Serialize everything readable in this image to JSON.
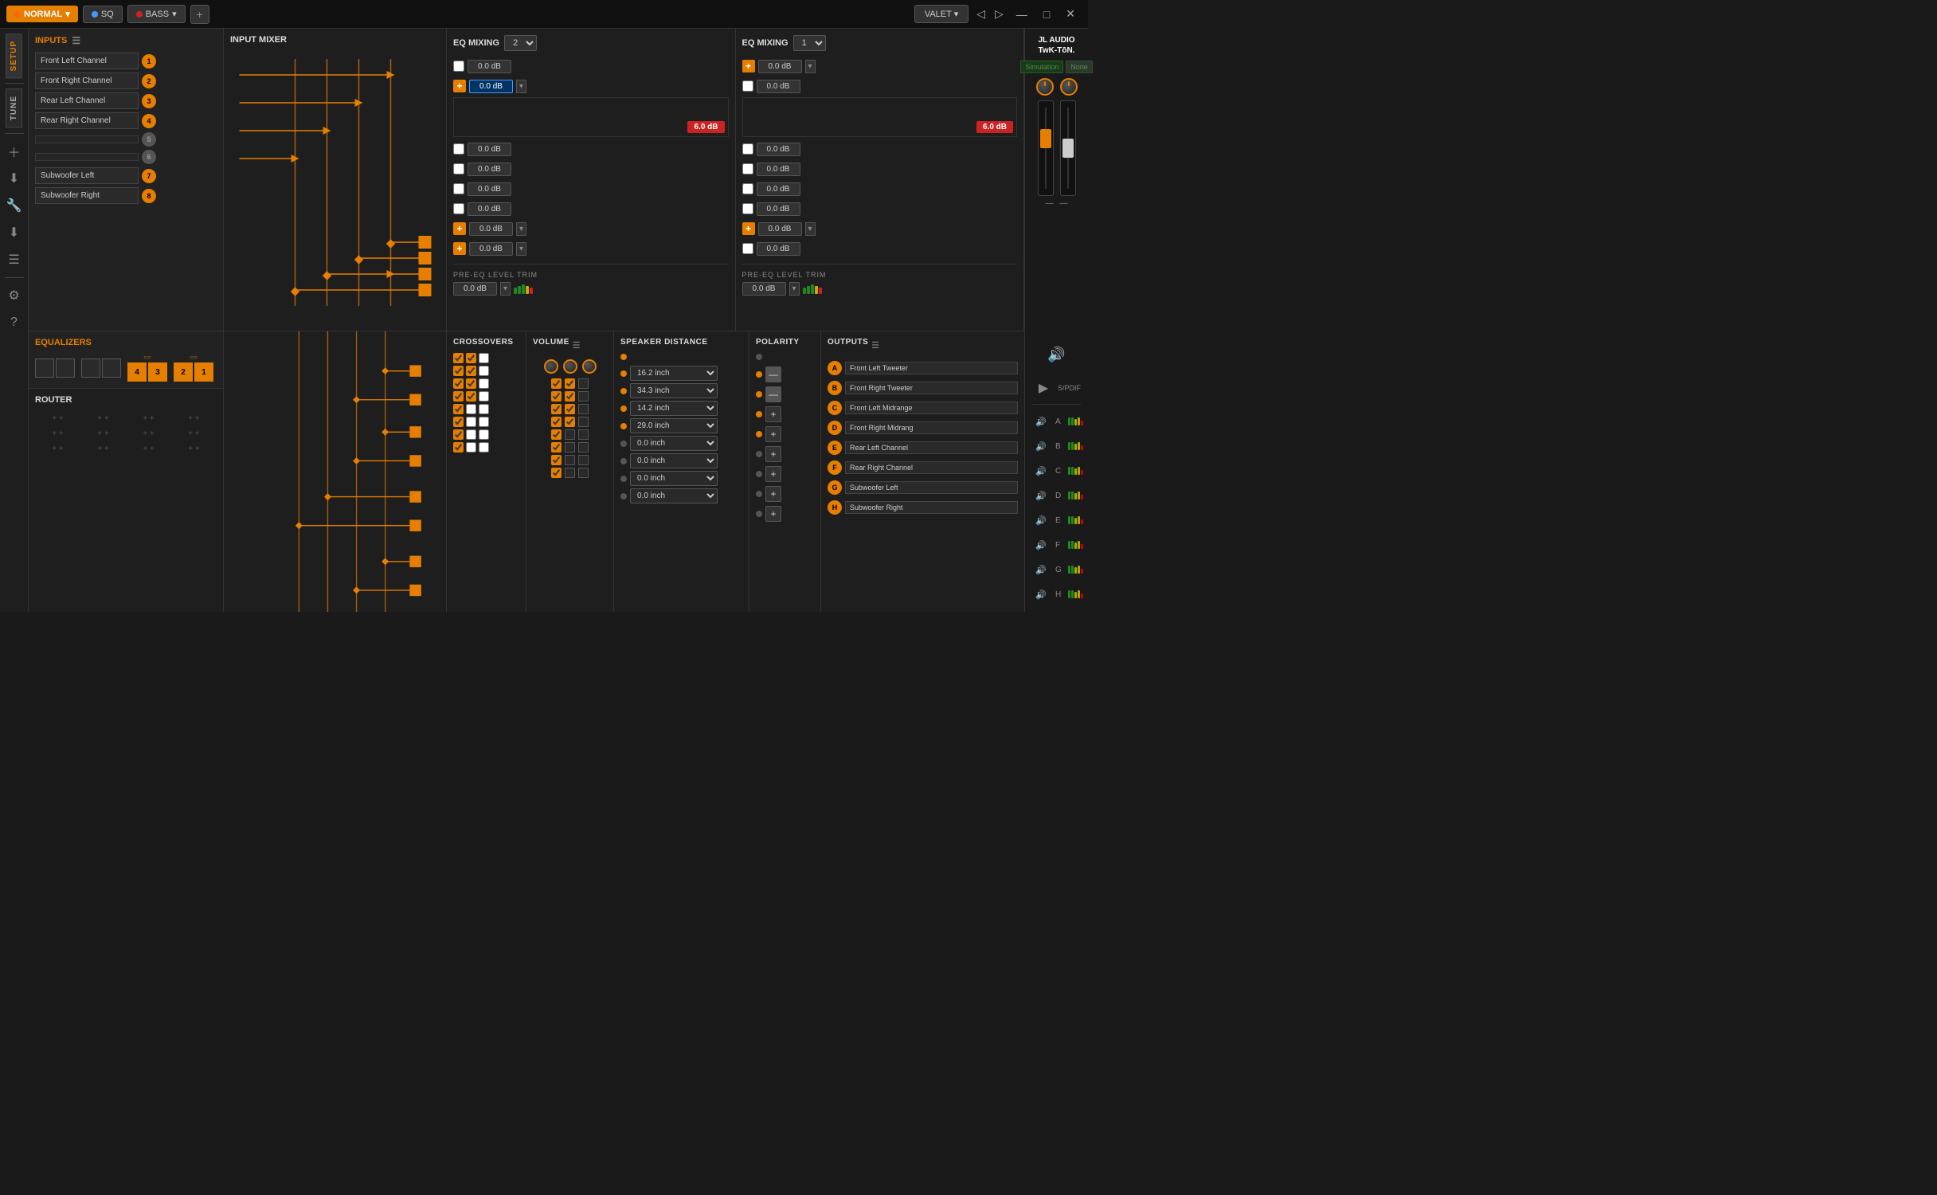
{
  "topbar": {
    "mode_label": "NORMAL",
    "sq_label": "SQ",
    "bass_label": "BASS",
    "add_label": "+",
    "valet_label": "VALET",
    "nav_back": "◁",
    "nav_fwd": "▷",
    "minimize": "—",
    "maximize": "□",
    "close": "✕"
  },
  "sidebar": {
    "setup_label": "SETUP",
    "tune_label": "TUNE"
  },
  "jl_logo": {
    "line1": "JL AUDIO",
    "line2": "TwK-TōN."
  },
  "simulation": {
    "sim_label": "Simulation",
    "none_label": "None"
  },
  "inputs": {
    "header": "INPUTS",
    "channels": [
      {
        "label": "Front Left Channel",
        "num": "1",
        "active": true
      },
      {
        "label": "Front Right Channel",
        "num": "2",
        "active": true
      },
      {
        "label": "Rear Left Channel",
        "num": "3",
        "active": true
      },
      {
        "label": "Rear Right Channel",
        "num": "4",
        "active": true
      },
      {
        "label": "",
        "num": "5",
        "active": false
      },
      {
        "label": "",
        "num": "6",
        "active": false
      },
      {
        "label": "Subwoofer Left",
        "num": "7",
        "active": true
      },
      {
        "label": "Subwoofer Right",
        "num": "8",
        "active": true
      }
    ]
  },
  "input_mixer": {
    "header": "INPUT MIXER"
  },
  "eq_mixing_left": {
    "label": "EQ MIXING",
    "value": "2",
    "rows": [
      {
        "has_plus": false,
        "db": "0.0 dB",
        "active": false
      },
      {
        "has_plus": true,
        "db": "0.0 dB",
        "active": true,
        "selected": true
      },
      {
        "has_plus": false,
        "db": "0.0 dB",
        "active": false
      },
      {
        "has_plus": false,
        "db": "0.0 dB",
        "active": false
      },
      {
        "has_plus": false,
        "db": "0.0 dB",
        "active": false
      },
      {
        "has_plus": false,
        "db": "0.0 dB",
        "active": false
      },
      {
        "has_plus": true,
        "db": "0.0 dB",
        "active": false
      },
      {
        "has_plus": true,
        "db": "0.0 dB",
        "active": false
      }
    ],
    "clip_badge": "6.0 dB",
    "pre_eq_label": "PRE-EQ LEVEL TRIM",
    "pre_eq_value": "0.0 dB"
  },
  "eq_mixing_right": {
    "label": "EQ MIXING",
    "value": "1",
    "rows": [
      {
        "has_plus": true,
        "db": "0.0 dB",
        "active": false
      },
      {
        "has_plus": false,
        "db": "0.0 dB",
        "active": false
      },
      {
        "has_plus": false,
        "db": "0.0 dB",
        "active": false
      },
      {
        "has_plus": false,
        "db": "0.0 dB",
        "active": false
      },
      {
        "has_plus": false,
        "db": "0.0 dB",
        "active": false
      },
      {
        "has_plus": false,
        "db": "0.0 dB",
        "active": false
      },
      {
        "has_plus": true,
        "db": "0.0 dB",
        "active": false
      },
      {
        "has_plus": false,
        "db": "0.0 dB",
        "active": false
      }
    ],
    "clip_badge": "6.0 dB",
    "pre_eq_label": "PRE-EQ LEVEL TRIM",
    "pre_eq_value": "0.0 dB"
  },
  "equalizers": {
    "header": "EQUALIZERS",
    "box_groups": [
      {
        "boxes": [
          {
            "num": "",
            "active": false
          },
          {
            "num": "",
            "active": false
          }
        ]
      },
      {
        "boxes": [
          {
            "num": "",
            "active": false
          },
          {
            "num": "",
            "active": false
          }
        ]
      },
      {
        "boxes": [
          {
            "num": "4",
            "active": true
          },
          {
            "num": "3",
            "active": true
          }
        ]
      },
      {
        "boxes": [
          {
            "num": "2",
            "active": true
          },
          {
            "num": "1",
            "active": true
          }
        ]
      }
    ]
  },
  "router": {
    "header": "ROUTER"
  },
  "crossovers": {
    "header": "CROSSOVERS",
    "rows": [
      [
        true,
        true,
        false
      ],
      [
        true,
        true,
        false
      ],
      [
        true,
        true,
        false
      ],
      [
        true,
        true,
        false
      ],
      [
        true,
        false,
        false
      ],
      [
        true,
        false,
        false
      ],
      [
        true,
        false,
        false
      ],
      [
        true,
        false,
        false
      ]
    ]
  },
  "volume": {
    "header": "VOLUME",
    "rows": [
      [
        true,
        true,
        false
      ],
      [
        true,
        true,
        false
      ],
      [
        true,
        true,
        false
      ],
      [
        true,
        true,
        false
      ],
      [
        true,
        false,
        false
      ],
      [
        true,
        false,
        false
      ],
      [
        true,
        false,
        false
      ],
      [
        true,
        false,
        false
      ]
    ]
  },
  "speaker_distance": {
    "header": "SPEAKER DISTANCE",
    "rows": [
      {
        "dot_active": true,
        "value": "16.2 inch"
      },
      {
        "dot_active": true,
        "value": "34.3 inch"
      },
      {
        "dot_active": true,
        "value": "14.2 inch"
      },
      {
        "dot_active": true,
        "value": "29.0 inch"
      },
      {
        "dot_active": false,
        "value": "0.0 inch"
      },
      {
        "dot_active": false,
        "value": "0.0 inch"
      },
      {
        "dot_active": false,
        "value": "0.0 inch"
      },
      {
        "dot_active": false,
        "value": "0.0 inch"
      }
    ]
  },
  "polarity": {
    "header": "POLARITY",
    "rows": [
      {
        "dot_active": true,
        "btn_type": "minus"
      },
      {
        "dot_active": true,
        "btn_type": "minus"
      },
      {
        "dot_active": true,
        "btn_type": "plus"
      },
      {
        "dot_active": true,
        "btn_type": "plus"
      },
      {
        "dot_active": false,
        "btn_type": "plus"
      },
      {
        "dot_active": false,
        "btn_type": "plus"
      },
      {
        "dot_active": false,
        "btn_type": "plus"
      },
      {
        "dot_active": false,
        "btn_type": "plus"
      }
    ]
  },
  "outputs": {
    "header": "OUTPUTS",
    "channels": [
      {
        "letter": "A",
        "label": "Front Left Tweeter"
      },
      {
        "letter": "B",
        "label": "Front Right Tweeter"
      },
      {
        "letter": "C",
        "label": "Front Left Midrange"
      },
      {
        "letter": "D",
        "label": "Front Right Midrang"
      },
      {
        "letter": "E",
        "label": "Rear Left Channel"
      },
      {
        "letter": "F",
        "label": "Rear Right Channel"
      },
      {
        "letter": "G",
        "label": "Subwoofer Left"
      },
      {
        "letter": "H",
        "label": "Subwoofer Right"
      }
    ]
  },
  "right_meters": {
    "spdif_label": "S/PDIF",
    "channels": [
      "A",
      "B",
      "C",
      "D",
      "E",
      "F",
      "G",
      "H"
    ]
  }
}
